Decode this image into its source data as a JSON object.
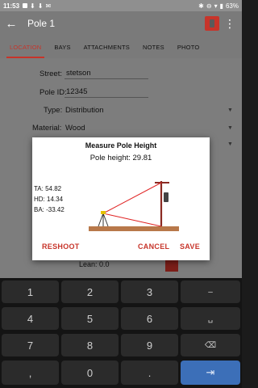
{
  "status_bar": {
    "time": "11:53",
    "battery": "63%"
  },
  "app_bar": {
    "title": "Pole 1",
    "back_glyph": "←",
    "menu_glyph": "⋮"
  },
  "tabs": [
    {
      "label": "LOCATION",
      "active": true
    },
    {
      "label": "BAYS",
      "active": false
    },
    {
      "label": "ATTACHMENTS",
      "active": false
    },
    {
      "label": "NOTES",
      "active": false
    },
    {
      "label": "PHOTO",
      "active": false
    }
  ],
  "form": {
    "street_label": "Street:",
    "street_value": "stetson",
    "pole_id_label": "Pole ID:",
    "pole_id_value": "12345",
    "type_label": "Type:",
    "type_value": "Distribution",
    "material_label": "Material:",
    "material_value": "Wood",
    "lean_label": "Lean:",
    "lean_value": "0.0"
  },
  "dialog": {
    "title": "Measure Pole Height",
    "pole_height": "Pole height: 29.81",
    "readings": {
      "ta": "TA: 54.82",
      "hd": "HD: 14.34",
      "ba": "BA: -33.42"
    },
    "reshoot_label": "RESHOOT",
    "cancel_label": "CANCEL",
    "save_label": "SAVE"
  },
  "keyboard": {
    "keys": {
      "k1": "1",
      "k2": "2",
      "k3": "3",
      "minus": "–",
      "k4": "4",
      "k5": "5",
      "k6": "6",
      "space": "␣",
      "k7": "7",
      "k8": "8",
      "k9": "9",
      "backspace": "⌫",
      "comma": ",",
      "k0": "0",
      "dot": ".",
      "enter": "⇥"
    }
  },
  "colors": {
    "accent": "#c7342a",
    "enter_key": "#3c6fb8"
  }
}
